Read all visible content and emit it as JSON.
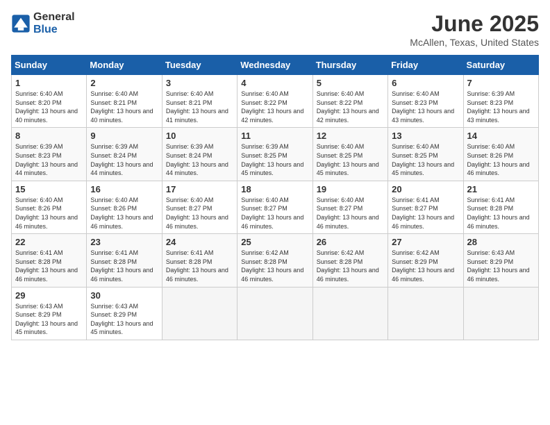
{
  "header": {
    "logo_general": "General",
    "logo_blue": "Blue",
    "month_year": "June 2025",
    "location": "McAllen, Texas, United States"
  },
  "weekdays": [
    "Sunday",
    "Monday",
    "Tuesday",
    "Wednesday",
    "Thursday",
    "Friday",
    "Saturday"
  ],
  "weeks": [
    [
      {
        "day": "1",
        "sunrise": "6:40 AM",
        "sunset": "8:20 PM",
        "daylight": "13 hours and 40 minutes."
      },
      {
        "day": "2",
        "sunrise": "6:40 AM",
        "sunset": "8:21 PM",
        "daylight": "13 hours and 40 minutes."
      },
      {
        "day": "3",
        "sunrise": "6:40 AM",
        "sunset": "8:21 PM",
        "daylight": "13 hours and 41 minutes."
      },
      {
        "day": "4",
        "sunrise": "6:40 AM",
        "sunset": "8:22 PM",
        "daylight": "13 hours and 42 minutes."
      },
      {
        "day": "5",
        "sunrise": "6:40 AM",
        "sunset": "8:22 PM",
        "daylight": "13 hours and 42 minutes."
      },
      {
        "day": "6",
        "sunrise": "6:40 AM",
        "sunset": "8:23 PM",
        "daylight": "13 hours and 43 minutes."
      },
      {
        "day": "7",
        "sunrise": "6:39 AM",
        "sunset": "8:23 PM",
        "daylight": "13 hours and 43 minutes."
      }
    ],
    [
      {
        "day": "8",
        "sunrise": "6:39 AM",
        "sunset": "8:23 PM",
        "daylight": "13 hours and 44 minutes."
      },
      {
        "day": "9",
        "sunrise": "6:39 AM",
        "sunset": "8:24 PM",
        "daylight": "13 hours and 44 minutes."
      },
      {
        "day": "10",
        "sunrise": "6:39 AM",
        "sunset": "8:24 PM",
        "daylight": "13 hours and 44 minutes."
      },
      {
        "day": "11",
        "sunrise": "6:39 AM",
        "sunset": "8:25 PM",
        "daylight": "13 hours and 45 minutes."
      },
      {
        "day": "12",
        "sunrise": "6:40 AM",
        "sunset": "8:25 PM",
        "daylight": "13 hours and 45 minutes."
      },
      {
        "day": "13",
        "sunrise": "6:40 AM",
        "sunset": "8:25 PM",
        "daylight": "13 hours and 45 minutes."
      },
      {
        "day": "14",
        "sunrise": "6:40 AM",
        "sunset": "8:26 PM",
        "daylight": "13 hours and 46 minutes."
      }
    ],
    [
      {
        "day": "15",
        "sunrise": "6:40 AM",
        "sunset": "8:26 PM",
        "daylight": "13 hours and 46 minutes."
      },
      {
        "day": "16",
        "sunrise": "6:40 AM",
        "sunset": "8:26 PM",
        "daylight": "13 hours and 46 minutes."
      },
      {
        "day": "17",
        "sunrise": "6:40 AM",
        "sunset": "8:27 PM",
        "daylight": "13 hours and 46 minutes."
      },
      {
        "day": "18",
        "sunrise": "6:40 AM",
        "sunset": "8:27 PM",
        "daylight": "13 hours and 46 minutes."
      },
      {
        "day": "19",
        "sunrise": "6:40 AM",
        "sunset": "8:27 PM",
        "daylight": "13 hours and 46 minutes."
      },
      {
        "day": "20",
        "sunrise": "6:41 AM",
        "sunset": "8:27 PM",
        "daylight": "13 hours and 46 minutes."
      },
      {
        "day": "21",
        "sunrise": "6:41 AM",
        "sunset": "8:28 PM",
        "daylight": "13 hours and 46 minutes."
      }
    ],
    [
      {
        "day": "22",
        "sunrise": "6:41 AM",
        "sunset": "8:28 PM",
        "daylight": "13 hours and 46 minutes."
      },
      {
        "day": "23",
        "sunrise": "6:41 AM",
        "sunset": "8:28 PM",
        "daylight": "13 hours and 46 minutes."
      },
      {
        "day": "24",
        "sunrise": "6:41 AM",
        "sunset": "8:28 PM",
        "daylight": "13 hours and 46 minutes."
      },
      {
        "day": "25",
        "sunrise": "6:42 AM",
        "sunset": "8:28 PM",
        "daylight": "13 hours and 46 minutes."
      },
      {
        "day": "26",
        "sunrise": "6:42 AM",
        "sunset": "8:28 PM",
        "daylight": "13 hours and 46 minutes."
      },
      {
        "day": "27",
        "sunrise": "6:42 AM",
        "sunset": "8:29 PM",
        "daylight": "13 hours and 46 minutes."
      },
      {
        "day": "28",
        "sunrise": "6:43 AM",
        "sunset": "8:29 PM",
        "daylight": "13 hours and 46 minutes."
      }
    ],
    [
      {
        "day": "29",
        "sunrise": "6:43 AM",
        "sunset": "8:29 PM",
        "daylight": "13 hours and 45 minutes."
      },
      {
        "day": "30",
        "sunrise": "6:43 AM",
        "sunset": "8:29 PM",
        "daylight": "13 hours and 45 minutes."
      },
      null,
      null,
      null,
      null,
      null
    ]
  ]
}
